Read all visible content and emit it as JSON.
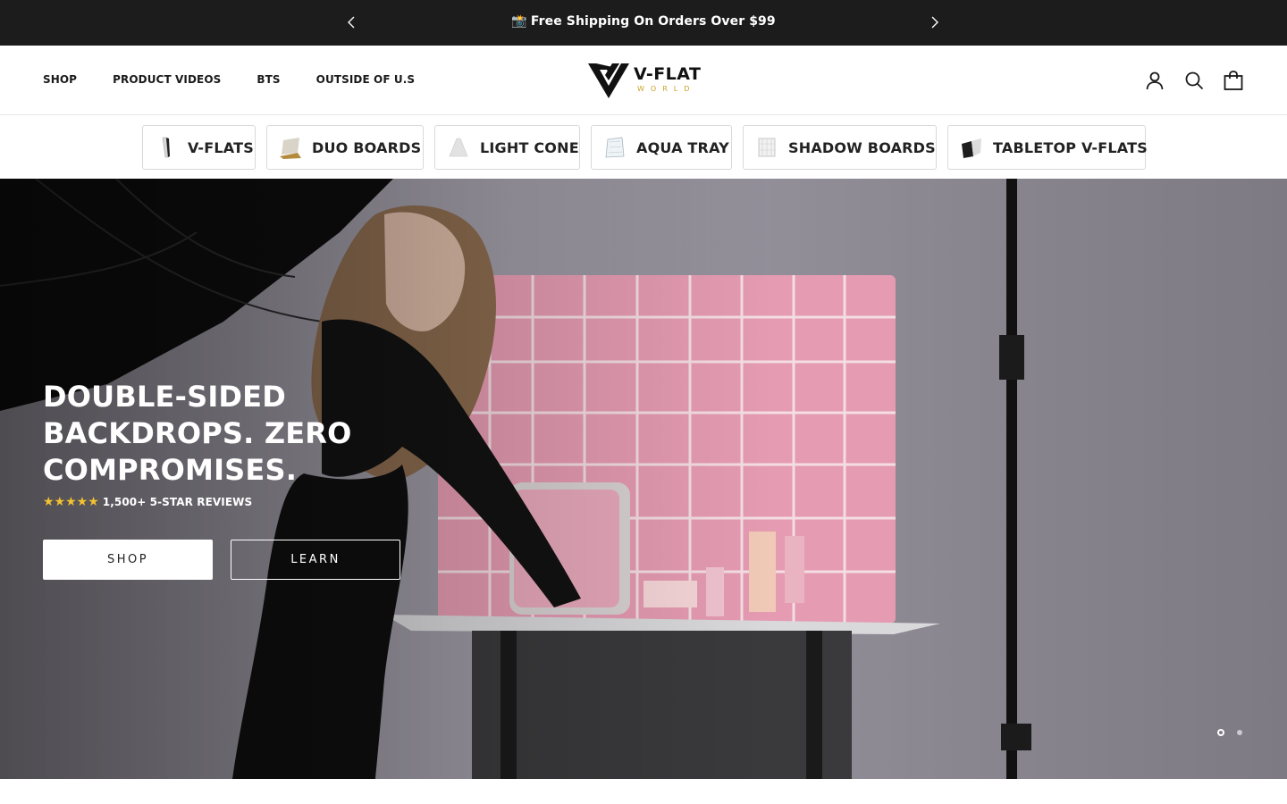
{
  "announcement": {
    "icon": "camera-emoji",
    "text": "Free Shipping On Orders Over $99"
  },
  "nav": {
    "items": [
      {
        "label": "SHOP"
      },
      {
        "label": "PRODUCT VIDEOS"
      },
      {
        "label": "BTS"
      },
      {
        "label": "OUTSIDE OF U.S"
      }
    ]
  },
  "logo": {
    "word": "V-FLAT",
    "sub": "WORLD"
  },
  "header_icons": [
    "account-icon",
    "search-icon",
    "cart-icon"
  ],
  "categories": [
    {
      "label": "V-FLATS"
    },
    {
      "label": "DUO BOARDS"
    },
    {
      "label": "LIGHT CONE"
    },
    {
      "label": "AQUA TRAY"
    },
    {
      "label": "SHADOW BOARDS"
    },
    {
      "label": "TABLETOP V-FLATS"
    }
  ],
  "hero": {
    "headline_line1": "DOUBLE-SIDED",
    "headline_line2": "BACKDROPS. ZERO",
    "headline_line3": "COMPROMISES.",
    "stars": "★★★★★",
    "rating_text": "1,500+ 5-STAR REVIEWS",
    "shop_label": "SHOP",
    "learn_label": "LEARN",
    "slide_count": 2,
    "active_slide": 1
  },
  "colors": {
    "announcement_bg": "#1c1c1c",
    "star": "#f2c230",
    "logo_accent": "#c9a227",
    "backdrop_pink": "#e59bb2"
  }
}
